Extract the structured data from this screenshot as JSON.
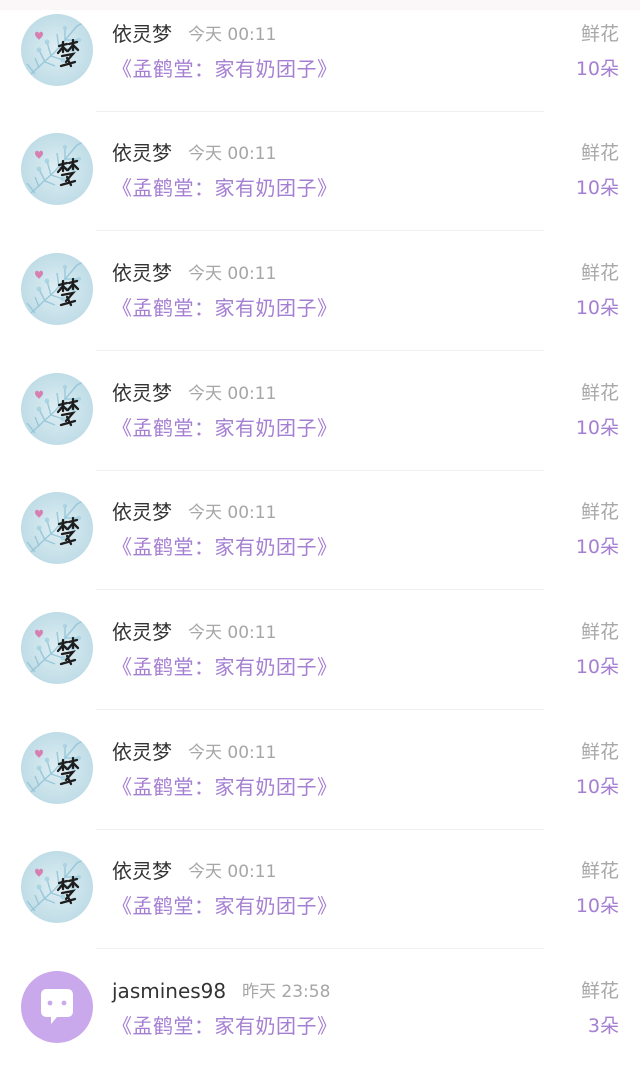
{
  "rows": [
    {
      "name": "依灵梦",
      "time": "今天 00:11",
      "book": "《孟鹤堂：家有奶团子》",
      "gift": "鲜花",
      "count": "10朵",
      "avatar": "meng-avatar-icon"
    },
    {
      "name": "依灵梦",
      "time": "今天 00:11",
      "book": "《孟鹤堂：家有奶团子》",
      "gift": "鲜花",
      "count": "10朵",
      "avatar": "meng-avatar-icon"
    },
    {
      "name": "依灵梦",
      "time": "今天 00:11",
      "book": "《孟鹤堂：家有奶团子》",
      "gift": "鲜花",
      "count": "10朵",
      "avatar": "meng-avatar-icon"
    },
    {
      "name": "依灵梦",
      "time": "今天 00:11",
      "book": "《孟鹤堂：家有奶团子》",
      "gift": "鲜花",
      "count": "10朵",
      "avatar": "meng-avatar-icon"
    },
    {
      "name": "依灵梦",
      "time": "今天 00:11",
      "book": "《孟鹤堂：家有奶团子》",
      "gift": "鲜花",
      "count": "10朵",
      "avatar": "meng-avatar-icon"
    },
    {
      "name": "依灵梦",
      "time": "今天 00:11",
      "book": "《孟鹤堂：家有奶团子》",
      "gift": "鲜花",
      "count": "10朵",
      "avatar": "meng-avatar-icon"
    },
    {
      "name": "依灵梦",
      "time": "今天 00:11",
      "book": "《孟鹤堂：家有奶团子》",
      "gift": "鲜花",
      "count": "10朵",
      "avatar": "meng-avatar-icon"
    },
    {
      "name": "依灵梦",
      "time": "今天 00:11",
      "book": "《孟鹤堂：家有奶团子》",
      "gift": "鲜花",
      "count": "10朵",
      "avatar": "meng-avatar-icon"
    },
    {
      "name": "jasmines98",
      "time": "昨天 23:58",
      "book": "《孟鹤堂：家有奶团子》",
      "gift": "鲜花",
      "count": "3朵",
      "avatar": "chat-bubble-avatar-icon"
    }
  ],
  "colors": {
    "name": "#333333",
    "time": "#a6a6a6",
    "accent": "#a57fd2",
    "gift": "#a8a8a8",
    "divider": "#f0f0f0"
  }
}
